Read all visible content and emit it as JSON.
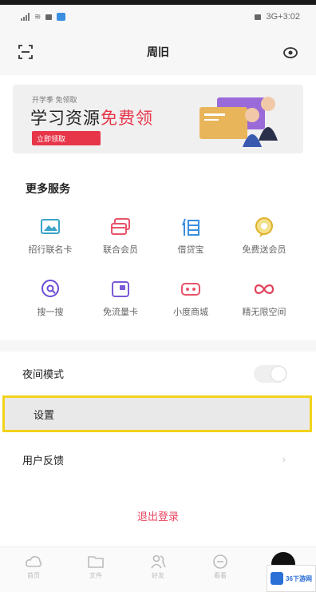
{
  "status_bar": {
    "time": "3G+3:02"
  },
  "nav": {
    "title": "周旧"
  },
  "banner": {
    "small_text": "开学季 免领取",
    "title_normal": "学习资源",
    "title_highlight": "免费领",
    "button_label": "立即领取"
  },
  "services": {
    "section_title": "更多服务",
    "items": [
      {
        "label": "招行联名卡",
        "icon": "image-card-icon",
        "color": "#3aa4c9"
      },
      {
        "label": "联合会员",
        "icon": "card-stack-icon",
        "color": "#e8546a"
      },
      {
        "label": "借贷宝",
        "icon": "borrow-icon",
        "color": "#3a8fe0"
      },
      {
        "label": "免费送会员",
        "icon": "gift-bubble-icon",
        "color": "#e0b12a"
      },
      {
        "label": "搜一搜",
        "icon": "search-bubble-icon",
        "color": "#6a4bd8"
      },
      {
        "label": "免流量卡",
        "icon": "data-card-icon",
        "color": "#7a5ad8"
      },
      {
        "label": "小度商城",
        "icon": "store-icon",
        "color": "#e8546a"
      },
      {
        "label": "精无限空间",
        "icon": "infinity-icon",
        "color": "#e0405a"
      }
    ]
  },
  "settings_rows": {
    "night_mode": "夜间模式",
    "settings": "设置",
    "feedback": "用户反馈"
  },
  "logout": "退出登录",
  "tabbar": {
    "items": [
      {
        "label": "首页",
        "icon": "cloud-icon"
      },
      {
        "label": "文件",
        "icon": "folder-icon"
      },
      {
        "label": "好友",
        "icon": "people-icon"
      },
      {
        "label": "看看",
        "icon": "clock-icon"
      }
    ]
  },
  "watermark": {
    "text": "36下游网"
  },
  "colors": {
    "accent_red": "#e7364a",
    "highlight": "#f2d21b"
  }
}
